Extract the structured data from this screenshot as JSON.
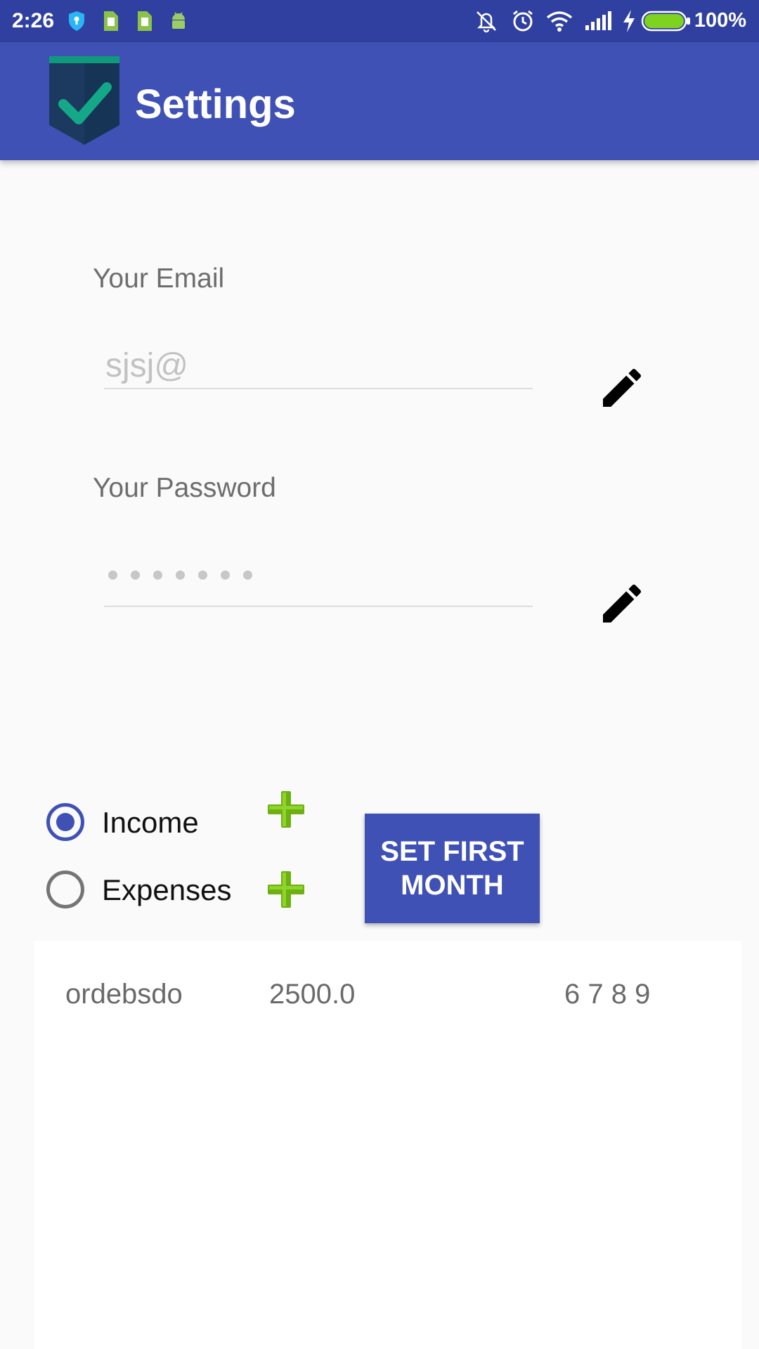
{
  "status_bar": {
    "time": "2:26",
    "battery_text": "100%",
    "icons": [
      "vpn-shield-icon",
      "sim-card-icon",
      "sim-card-icon",
      "android-icon",
      "vibrate-off-icon",
      "alarm-icon",
      "wifi-icon",
      "signal-icon",
      "charging-icon",
      "battery-icon"
    ],
    "background_color": "#3040a0",
    "battery_color": "#7ed321"
  },
  "app_bar": {
    "title": "Settings",
    "logo": "checkmark-shield-icon",
    "background_color": "#3f51b5"
  },
  "email": {
    "label": "Your Email",
    "value": "sjsj@",
    "edit_icon": "pencil-icon"
  },
  "password": {
    "label": "Your Password",
    "masked_length": 7,
    "edit_icon": "pencil-icon"
  },
  "type_selector": {
    "options": [
      {
        "label": "Income",
        "selected": true
      },
      {
        "label": "Expenses",
        "selected": false
      }
    ],
    "add_icon": "plus-icon",
    "accent_color": "#3f51b5",
    "plus_color": "#6cb012"
  },
  "set_first_month_button": {
    "label": "SET FIRST\nMONTH"
  },
  "records": [
    {
      "name": "ordebsdo",
      "amount": "2500.0",
      "months": "6 7 8 9"
    }
  ]
}
